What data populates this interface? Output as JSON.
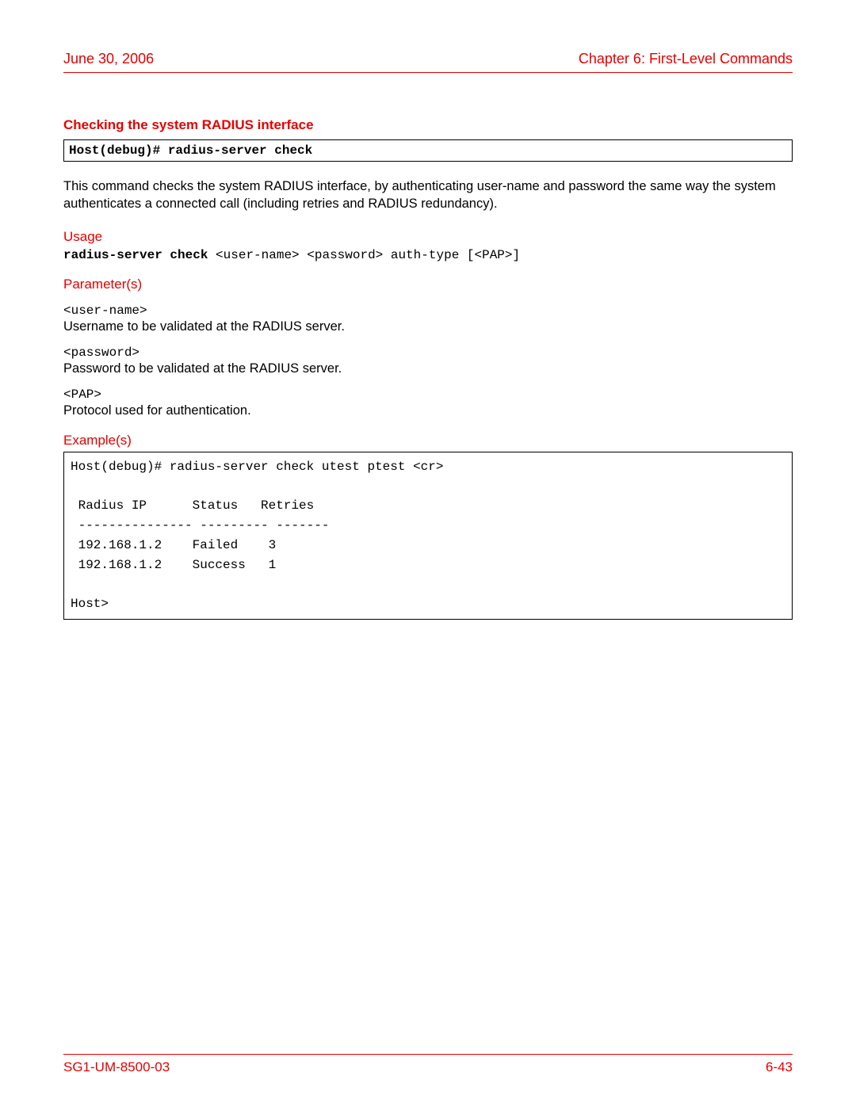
{
  "header": {
    "date": "June 30, 2006",
    "chapter": "Chapter 6: First-Level Commands"
  },
  "section": {
    "title": "Checking the system RADIUS interface",
    "command": "Host(debug)# radius-server check",
    "description": "This command checks the system RADIUS interface, by authenticating user-name and password the same way the system authenticates a connected call (including retries and RADIUS redundancy)."
  },
  "usage": {
    "heading": "Usage",
    "bold_part": "radius-server check",
    "rest": " <user-name> <password> auth-type [<PAP>]"
  },
  "parameters": {
    "heading": "Parameter(s)",
    "items": [
      {
        "name": "<user-name>",
        "desc": "Username to be validated at the RADIUS server."
      },
      {
        "name": "<password>",
        "desc": "Password to be validated at the RADIUS server."
      },
      {
        "name": "<PAP>",
        "desc": "Protocol used for authentication."
      }
    ]
  },
  "examples": {
    "heading": "Example(s)",
    "text": "Host(debug)# radius-server check utest ptest <cr>\n\n Radius IP      Status   Retries\n --------------- --------- -------\n 192.168.1.2    Failed    3\n 192.168.1.2    Success   1\n\nHost>"
  },
  "footer": {
    "docid": "SG1-UM-8500-03",
    "pagenum": "6-43"
  }
}
